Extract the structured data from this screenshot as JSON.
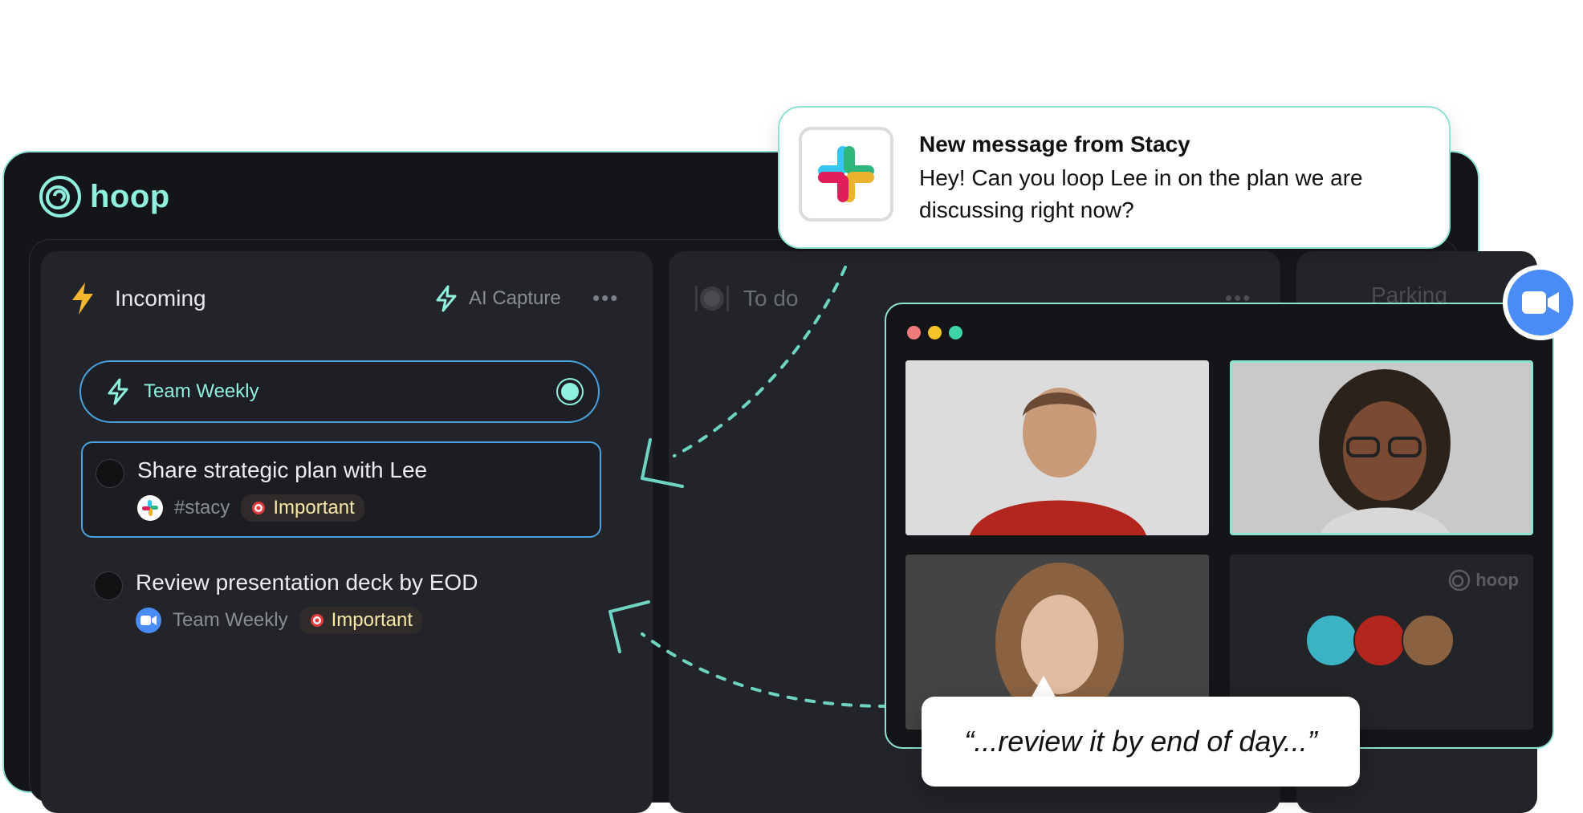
{
  "app": {
    "logo_text": "hoop"
  },
  "columns": [
    {
      "title": "Incoming",
      "capture_label": "AI Capture"
    },
    {
      "title": "To do"
    },
    {
      "title": "Parking"
    }
  ],
  "capture_source": {
    "label": "Team Weekly"
  },
  "tasks": [
    {
      "title": "Share strategic plan with Lee",
      "source": "#stacy",
      "source_icon": "slack-icon",
      "tag": "Important"
    },
    {
      "title": "Review presentation deck by EOD",
      "source": "Team Weekly",
      "source_icon": "zoom-icon",
      "tag": "Important"
    }
  ],
  "notification": {
    "title": "New message from Stacy",
    "body": "Hey! Can you loop Lee in on the plan we are discussing right now?"
  },
  "meeting": {
    "watermark": "hoop",
    "quote": "“...review it by end of day...”"
  },
  "colors": {
    "accent": "#8ff0de",
    "border_blue": "#4aa3e0",
    "zoom_blue": "#4a8cf7",
    "bg_dark": "#141518"
  }
}
